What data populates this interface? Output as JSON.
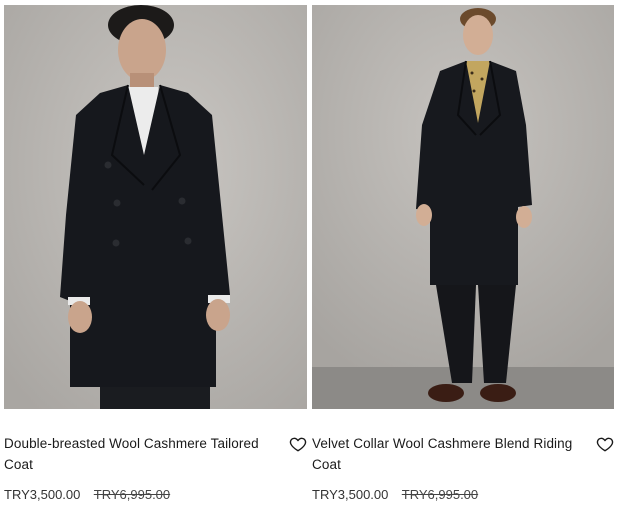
{
  "products": [
    {
      "name": "Double-breasted Wool Cashmere Tailored Coat",
      "price": "TRY3,500.00",
      "original_price": "TRY6,995.00",
      "wishlist_icon": "heart-outline-icon"
    },
    {
      "name": "Velvet Collar Wool Cashmere Blend Riding Coat",
      "price": "TRY3,500.00",
      "original_price": "TRY6,995.00",
      "wishlist_icon": "heart-outline-icon"
    }
  ],
  "colors": {
    "backdrop": "#b9b6b2",
    "floor": "#8c8a87",
    "coat": "#16181d",
    "text": "#1a1a1a"
  }
}
